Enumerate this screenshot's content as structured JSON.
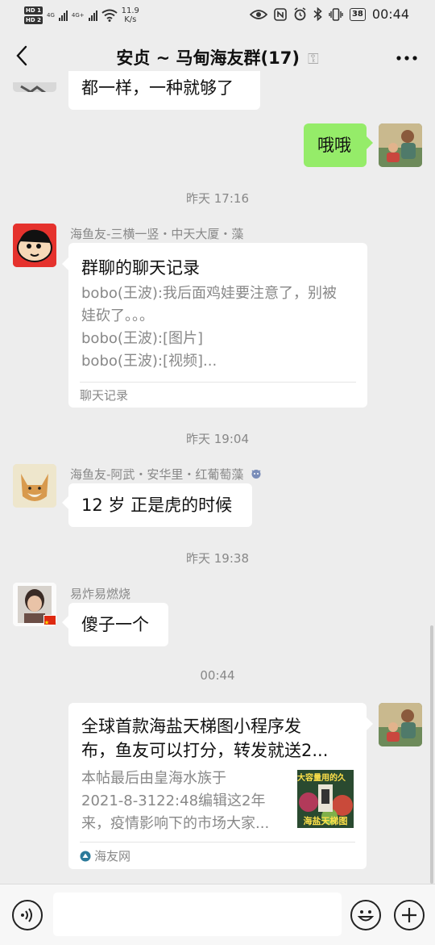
{
  "status_bar": {
    "hd1": "HD 1",
    "hd2": "HD 2",
    "net1": "4G",
    "net2": "4G+",
    "speed_value": "11.9",
    "speed_unit": "K/s",
    "battery": "38",
    "time": "00:44",
    "icons": [
      "eye-icon",
      "nfc-icon",
      "alarm-icon",
      "bluetooth-icon",
      "vibrate-icon",
      "battery-icon"
    ]
  },
  "header": {
    "title": "安贞 ~ 马甸海友群(17)",
    "back_icon": "chevron-left-icon",
    "mute_icon": "ear-icon",
    "more_icon": "more-icon"
  },
  "messages": {
    "partial_top": {
      "text": "都一样，一种就够了"
    },
    "mine1": {
      "text": "哦哦"
    },
    "time1": "昨天 17:16",
    "chatlog": {
      "sender": "海鱼友-三横一竖・中天大厦・藻",
      "title": "群聊的聊天记录",
      "lines": [
        "bobo(王波):我后面鸡娃要注意了，别被",
        "娃砍了。。。",
        "bobo(王波):[图片]",
        "bobo(王波):[视频]..."
      ],
      "footer": "聊天记录"
    },
    "time2": "昨天 19:04",
    "msg_wu": {
      "sender": "海鱼友-阿武・安华里・红葡萄藻",
      "text": "12 岁 正是虎的时候",
      "badge_icon": "face-badge-icon"
    },
    "time3": "昨天 19:38",
    "msg_yi": {
      "sender": "易炸易燃烧",
      "text": "傻子一个",
      "flag_icon": "china-flag-icon"
    },
    "time4": "00:44",
    "link": {
      "title_line1": "全球首款海盐天梯图小程序发",
      "title_line2": "布，鱼友可以打分，转发就送2...",
      "desc_line1": "本帖最后由皇海水族于",
      "desc_line2": "2021-8-3122:48编辑这2年",
      "desc_line3": "来，疫情影响下的市场大家...",
      "thumb_top": "大容量用的久",
      "thumb_bottom": "海盐天梯图",
      "source": "海友网"
    }
  },
  "input_bar": {
    "voice_icon": "voice-icon",
    "emoji_icon": "emoji-icon",
    "plus_icon": "plus-icon",
    "value": ""
  },
  "colors": {
    "background": "#ededed",
    "my_bubble": "#95ec69",
    "their_bubble": "#ffffff",
    "meta_text": "#888888"
  }
}
